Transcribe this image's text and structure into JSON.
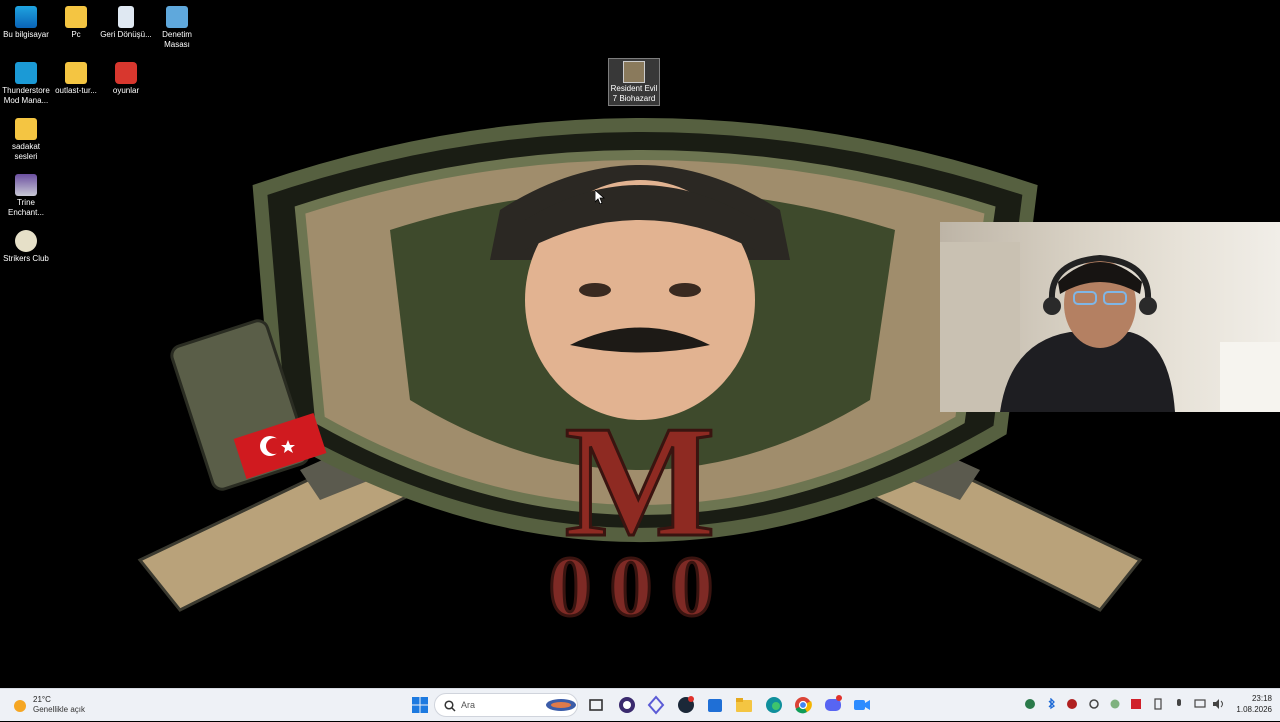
{
  "desktop": {
    "icons": [
      {
        "name": "this-pc-icon",
        "label": "Bu bilgisayar"
      },
      {
        "name": "pc-folder-icon",
        "label": "Pc"
      },
      {
        "name": "recycle-bin-icon",
        "label": "Geri Dönüşü..."
      },
      {
        "name": "control-panel-icon",
        "label": "Denetim Masası"
      },
      {
        "name": "thunderstore-icon",
        "label": "Thunderstore Mod Mana..."
      },
      {
        "name": "outlast-folder-icon",
        "label": "outlast-tur..."
      },
      {
        "name": "oyunlar-icon",
        "label": "oyunlar"
      },
      {
        "name": "sadakat-folder-icon",
        "label": "sadakat sesleri"
      },
      {
        "name": "trine-icon",
        "label": "Trine Enchant..."
      },
      {
        "name": "strikers-club-icon",
        "label": "Strikers Club"
      }
    ],
    "selected_icon": {
      "label": "Resident Evil 7 Biohazard"
    },
    "wallpaper": {
      "letter": "M",
      "number": "000",
      "flag": "Turkey"
    }
  },
  "taskbar": {
    "weather": {
      "temp": "21°C",
      "condition": "Genellikle açık"
    },
    "search": {
      "placeholder": "Ara"
    },
    "clock": {
      "time": "23:18",
      "date": "1.08.2026"
    },
    "apps": [
      "start-icon",
      "search-icon",
      "task-view-icon",
      "obs-icon",
      "app-icon",
      "steam-icon",
      "store-icon",
      "file-explorer-icon",
      "edge-icon",
      "chrome-icon",
      "discord-icon",
      "zoom-icon"
    ],
    "tray": [
      "copilot-icon",
      "bluetooth-icon",
      "steam-tray-icon",
      "settings-tray-icon",
      "nvidia-icon",
      "app-tray-icon",
      "battery-icon",
      "mic-icon",
      "network-icon",
      "wifi-icon",
      "volume-icon"
    ]
  },
  "colors": {
    "taskbar_bg": "#eef1f6",
    "emblem_green": "#3e4a2c",
    "letter_red": "#8e2a22"
  }
}
